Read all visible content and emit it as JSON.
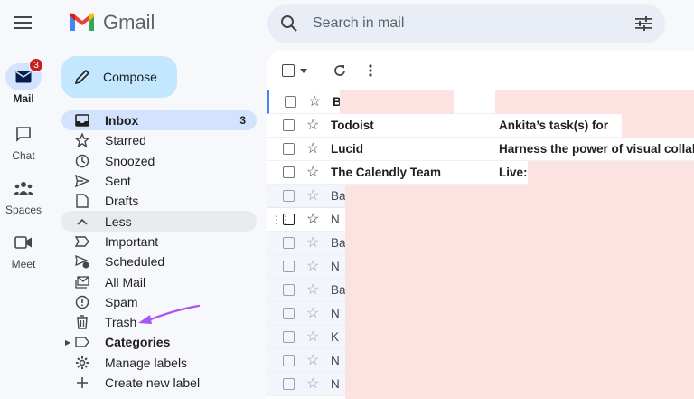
{
  "header": {
    "app_name": "Gmail",
    "search_placeholder": "Search in mail",
    "icons": {
      "menu": "hamburger-menu-icon",
      "search": "search-icon",
      "filter": "tune-filter-icon"
    }
  },
  "rail": {
    "items": [
      {
        "label": "Mail",
        "icon": "mail-icon",
        "badge": "3",
        "active": true
      },
      {
        "label": "Chat",
        "icon": "chat-icon"
      },
      {
        "label": "Spaces",
        "icon": "spaces-icon"
      },
      {
        "label": "Meet",
        "icon": "video-icon"
      }
    ]
  },
  "compose": {
    "label": "Compose",
    "icon": "pencil-icon"
  },
  "nav": {
    "items": [
      {
        "label": "Inbox",
        "icon": "inbox-icon",
        "count": "3",
        "state": "active"
      },
      {
        "label": "Starred",
        "icon": "star-icon"
      },
      {
        "label": "Snoozed",
        "icon": "clock-icon"
      },
      {
        "label": "Sent",
        "icon": "send-icon"
      },
      {
        "label": "Drafts",
        "icon": "draft-icon"
      },
      {
        "label": "Less",
        "icon": "chevron-up-icon",
        "state": "hover"
      },
      {
        "label": "Important",
        "icon": "important-icon"
      },
      {
        "label": "Scheduled",
        "icon": "scheduled-icon"
      },
      {
        "label": "All Mail",
        "icon": "all-mail-icon"
      },
      {
        "label": "Spam",
        "icon": "spam-icon"
      },
      {
        "label": "Trash",
        "icon": "trash-icon"
      },
      {
        "label": "Categories",
        "icon": "label-icon",
        "bold": true
      },
      {
        "label": "Manage labels",
        "icon": "gear-icon"
      },
      {
        "label": "Create new label",
        "icon": "plus-icon"
      }
    ]
  },
  "annotation": {
    "color": "#a855f7",
    "target": "Trash"
  },
  "toolbar": {
    "icons": [
      "select-all-checkbox-icon",
      "dropdown-caret-icon",
      "refresh-icon",
      "more-vert-icon"
    ]
  },
  "emails": [
    {
      "sender": "B",
      "subject": "",
      "unread": true,
      "selected": true
    },
    {
      "sender": "Todoist",
      "subject": "Ankita’s task(s) for",
      "unread": true
    },
    {
      "sender": "Lucid",
      "subject": "Harness the power of visual collab",
      "unread": true
    },
    {
      "sender": "The Calendly Team",
      "subject": "Live:",
      "unread": true
    },
    {
      "sender": "Ba",
      "subject": "",
      "unread": false
    },
    {
      "sender": "N",
      "subject": "",
      "unread": false,
      "hover": true
    },
    {
      "sender": "Ba",
      "subject": "",
      "unread": false
    },
    {
      "sender": "N",
      "subject": "",
      "unread": false
    },
    {
      "sender": "Ba",
      "subject": "",
      "unread": false
    },
    {
      "sender": "N",
      "subject": "",
      "unread": false
    },
    {
      "sender": "K",
      "subject": "",
      "unread": false
    },
    {
      "sender": "N",
      "subject": "",
      "unread": false
    },
    {
      "sender": "N",
      "subject": "",
      "unread": false
    }
  ],
  "colors": {
    "redaction": "#fde2e2",
    "accent": "#0b57d0",
    "badge": "#c5221f"
  }
}
